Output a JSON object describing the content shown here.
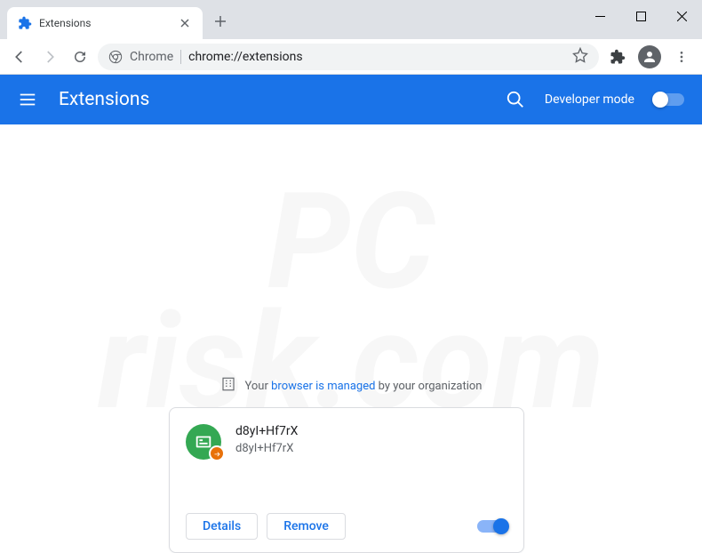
{
  "window": {
    "tab_title": "Extensions"
  },
  "omnibox": {
    "scheme_label": "Chrome",
    "url": "chrome://extensions"
  },
  "header": {
    "title": "Extensions",
    "dev_mode_label": "Developer mode"
  },
  "managed": {
    "prefix": "Your ",
    "link": "browser is managed",
    "suffix": " by your organization"
  },
  "extension": {
    "name": "d8yI+Hf7rX",
    "description": "d8yI+Hf7rX",
    "details_label": "Details",
    "remove_label": "Remove",
    "enabled": true
  },
  "watermark": {
    "line1": "PC",
    "line2": "risk.com"
  }
}
